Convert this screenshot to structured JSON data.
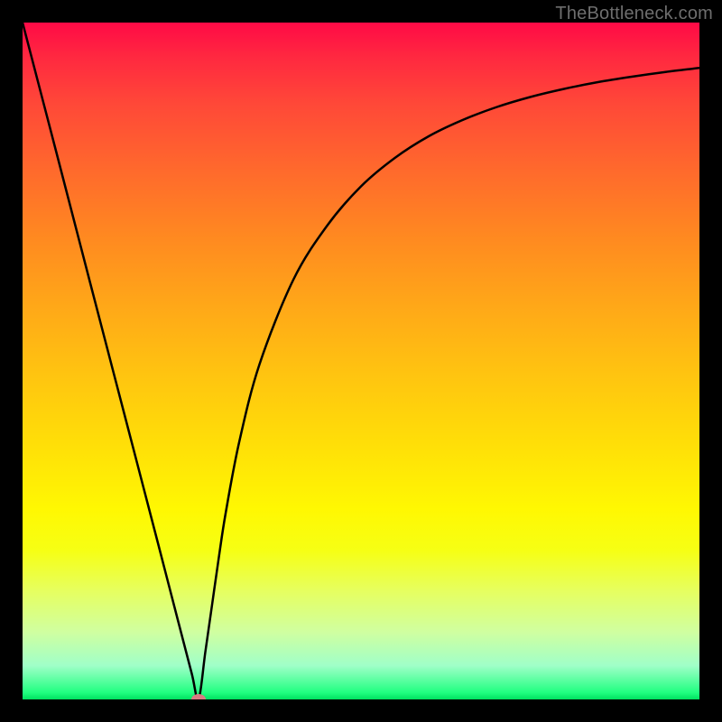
{
  "watermark": "TheBottleneck.com",
  "colors": {
    "frame": "#000000",
    "curve": "#000000",
    "marker": "#d87a82"
  },
  "chart_data": {
    "type": "line",
    "title": "",
    "xlabel": "",
    "ylabel": "",
    "xlim": [
      0,
      100
    ],
    "ylim": [
      0,
      100
    ],
    "grid": false,
    "legend": false,
    "x": [
      0,
      5,
      10,
      15,
      20,
      23,
      25,
      26,
      27,
      28,
      29,
      30,
      32,
      35,
      40,
      45,
      50,
      55,
      60,
      65,
      70,
      75,
      80,
      85,
      90,
      95,
      100
    ],
    "values": [
      100,
      80.8,
      61.5,
      42.3,
      23.1,
      11.5,
      3.8,
      0.0,
      7.0,
      14.0,
      21.0,
      27.5,
      38.0,
      49.5,
      62.0,
      70.0,
      75.8,
      80.0,
      83.2,
      85.6,
      87.5,
      89.0,
      90.2,
      91.2,
      92.0,
      92.7,
      93.3
    ],
    "marker": {
      "x": 26,
      "y": 0
    }
  }
}
